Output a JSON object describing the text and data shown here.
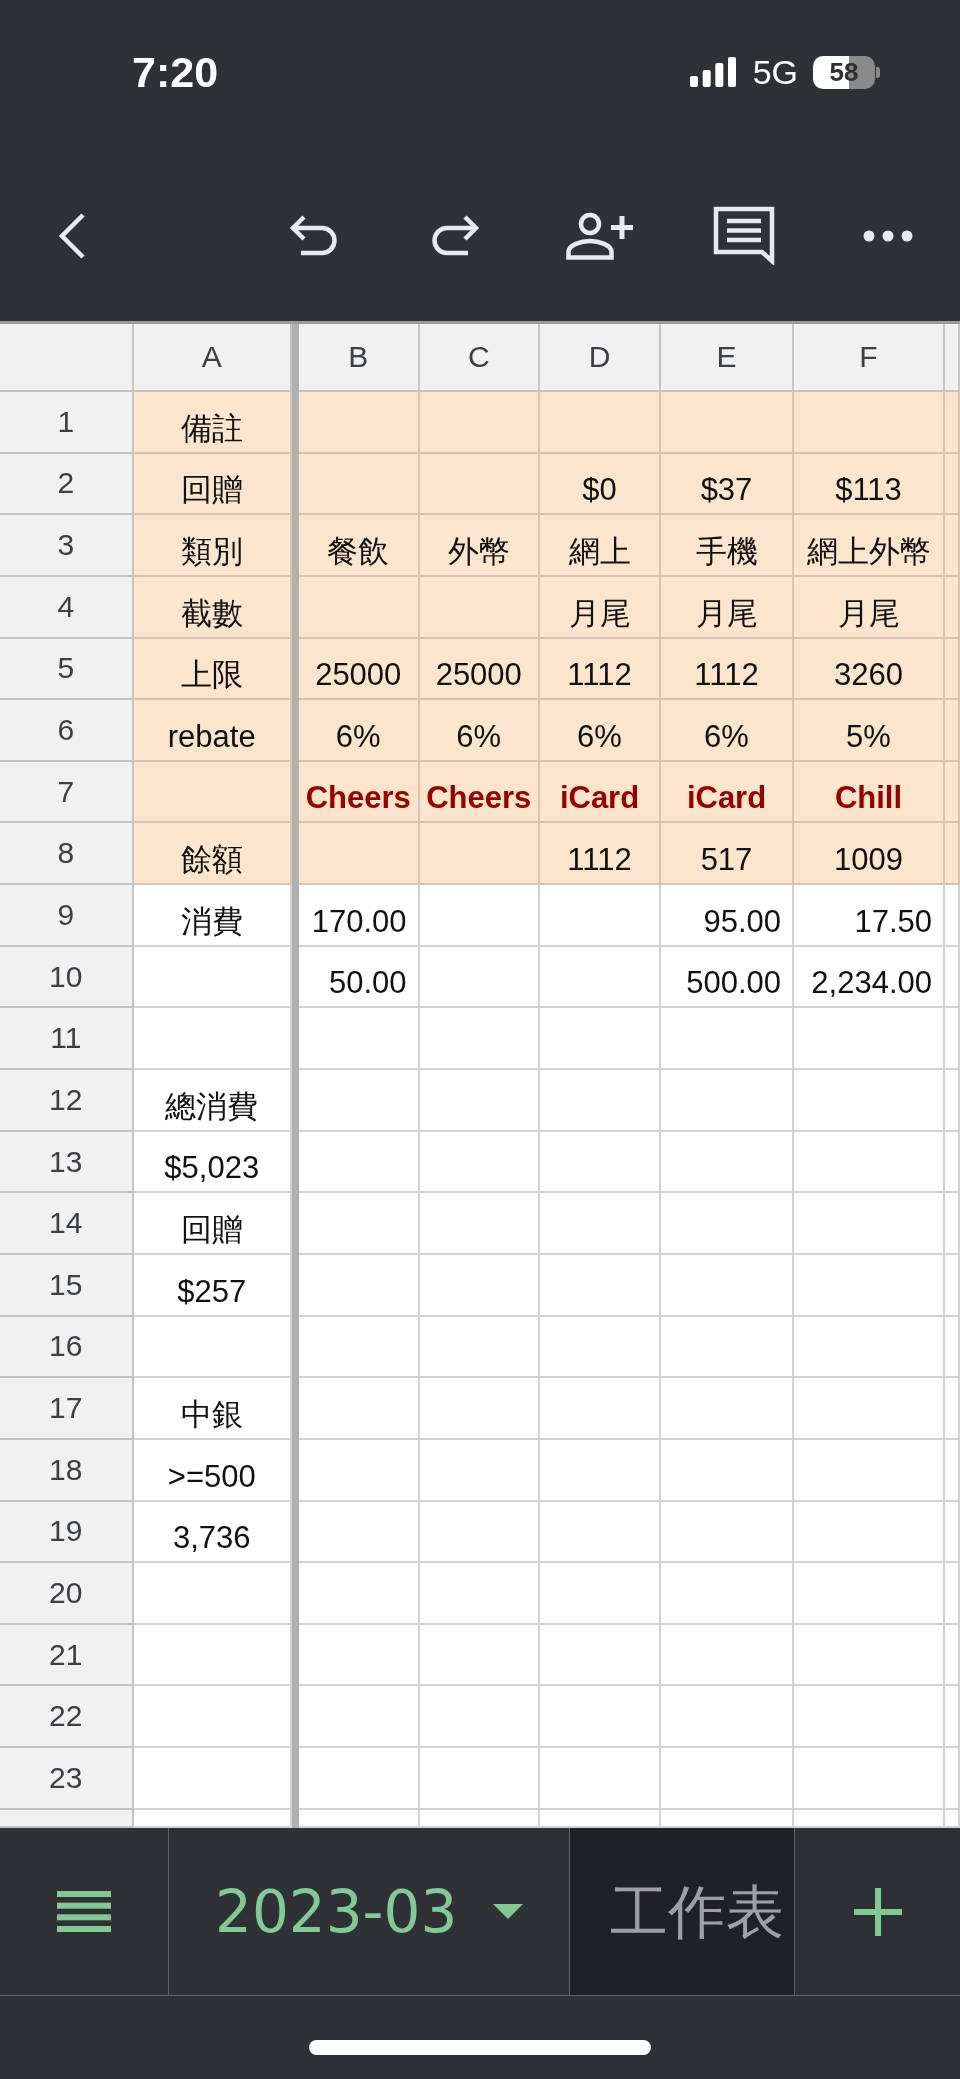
{
  "status_bar": {
    "time": "7:20",
    "network": "5G",
    "battery": "58"
  },
  "sheet": {
    "columns": [
      "A",
      "B",
      "C",
      "D",
      "E",
      "F"
    ],
    "rows": [
      {
        "number": "1",
        "color": "#fce5cd",
        "cells": [
          {
            "text": "備註",
            "kind": "plain"
          }
        ]
      },
      {
        "number": "2",
        "color": "#fce5cd",
        "cells": [
          {
            "text": "回贈",
            "kind": "plain"
          },
          null,
          null,
          {
            "text": "$0",
            "kind": "plain"
          },
          {
            "text": "$37",
            "kind": "plain"
          },
          {
            "text": "$113",
            "kind": "plain"
          }
        ]
      },
      {
        "number": "3",
        "color": "#fce5cd",
        "cells": [
          {
            "text": "類別",
            "kind": "plain"
          },
          {
            "text": "餐飲",
            "kind": "plain"
          },
          {
            "text": "外幣",
            "kind": "plain"
          },
          {
            "text": "網上",
            "kind": "plain"
          },
          {
            "text": "手機",
            "kind": "plain"
          },
          {
            "text": "網上外幣",
            "kind": "plain"
          }
        ]
      },
      {
        "number": "4",
        "color": "#fce5cd",
        "cells": [
          {
            "text": "截數",
            "kind": "plain"
          },
          null,
          null,
          {
            "text": "月尾",
            "kind": "plain"
          },
          {
            "text": "月尾",
            "kind": "plain"
          },
          {
            "text": "月尾",
            "kind": "plain"
          }
        ]
      },
      {
        "number": "5",
        "color": "#fce5cd",
        "cells": [
          {
            "text": "上限",
            "kind": "plain"
          },
          {
            "text": "25000",
            "kind": "plain"
          },
          {
            "text": "25000",
            "kind": "plain"
          },
          {
            "text": "1112",
            "kind": "plain"
          },
          {
            "text": "1112",
            "kind": "plain"
          },
          {
            "text": "3260",
            "kind": "plain"
          }
        ]
      },
      {
        "number": "6",
        "color": "#fce5cd",
        "cells": [
          {
            "text": "rebate",
            "kind": "plain"
          },
          {
            "text": "6%",
            "kind": "plain"
          },
          {
            "text": "6%",
            "kind": "plain"
          },
          {
            "text": "6%",
            "kind": "plain"
          },
          {
            "text": "6%",
            "kind": "plain"
          },
          {
            "text": "5%",
            "kind": "plain"
          }
        ]
      },
      {
        "number": "7",
        "color": "#fce5cd",
        "cells": [
          null,
          {
            "text": "Cheers",
            "kind": "bold"
          },
          {
            "text": "Cheers",
            "kind": "bold"
          },
          {
            "text": "iCard",
            "kind": "bold"
          },
          {
            "text": "iCard",
            "kind": "bold"
          },
          {
            "text": "Chill",
            "kind": "bold"
          }
        ]
      },
      {
        "number": "8",
        "color": "#fce5cd",
        "cells": [
          {
            "text": "餘額",
            "kind": "plain"
          },
          null,
          null,
          {
            "text": "1112",
            "kind": "plain"
          },
          {
            "text": "517",
            "kind": "plain"
          },
          {
            "text": "1009",
            "kind": "plain"
          }
        ]
      },
      {
        "number": "9",
        "cells": [
          {
            "text": "消費",
            "kind": "plain"
          },
          {
            "text": "170.00",
            "kind": "number"
          },
          null,
          null,
          {
            "text": "95.00",
            "kind": "number"
          },
          {
            "text": "17.50",
            "kind": "number"
          }
        ]
      },
      {
        "number": "10",
        "cells": [
          null,
          {
            "text": "50.00",
            "kind": "number"
          },
          null,
          null,
          {
            "text": "500.00",
            "kind": "number"
          },
          {
            "text": "2,234.00",
            "kind": "number"
          }
        ]
      },
      {
        "number": "11"
      },
      {
        "number": "12",
        "cells": [
          {
            "text": "總消費",
            "kind": "plain"
          }
        ]
      },
      {
        "number": "13",
        "cells": [
          {
            "text": "$5,023",
            "kind": "plain"
          }
        ]
      },
      {
        "number": "14",
        "cells": [
          {
            "text": "回贈",
            "kind": "plain"
          }
        ]
      },
      {
        "number": "15",
        "cells": [
          {
            "text": "$257",
            "kind": "plain"
          }
        ]
      },
      {
        "number": "16"
      },
      {
        "number": "17",
        "cells": [
          {
            "text": "中銀",
            "kind": "plain"
          }
        ]
      },
      {
        "number": "18",
        "cells": [
          {
            "text": ">=500",
            "kind": "plain"
          }
        ]
      },
      {
        "number": "19",
        "cells": [
          {
            "text": "3,736",
            "kind": "plain"
          }
        ]
      },
      {
        "number": "20"
      },
      {
        "number": "21"
      },
      {
        "number": "22"
      },
      {
        "number": "23"
      }
    ]
  },
  "sheet_tabs": [
    {
      "label": "2023-03",
      "selected": true
    },
    {
      "label": "工作表",
      "selected": false
    }
  ]
}
